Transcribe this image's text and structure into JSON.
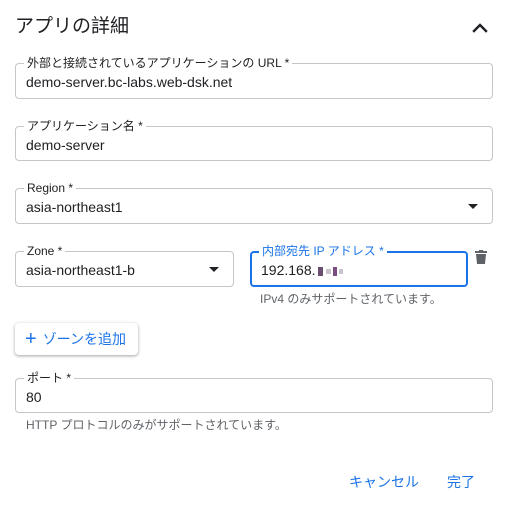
{
  "section": {
    "title": "アプリの詳細"
  },
  "fields": {
    "url": {
      "label": "外部と接続されているアプリケーションの URL *",
      "value": "demo-server.bc-labs.web-dsk.net"
    },
    "app_name": {
      "label": "アプリケーション名 *",
      "value": "demo-server"
    },
    "region": {
      "label": "Region *",
      "value": "asia-northeast1"
    },
    "zone": {
      "label": "Zone *",
      "value": "asia-northeast1-b"
    },
    "internal_ip": {
      "label": "内部宛先 IP アドレス *",
      "value": "192.168.",
      "hint": "IPv4 のみサポートされています。"
    },
    "port": {
      "label": "ポート *",
      "value": "80",
      "hint": "HTTP プロトコルのみがサポートされています。"
    }
  },
  "buttons": {
    "add_zone": "ゾーンを追加",
    "cancel": "キャンセル",
    "done": "完了"
  },
  "icons": {
    "collapse": "chevron-up-icon",
    "delete": "trash-icon",
    "add": "plus-icon",
    "dropdown": "caret-down-icon"
  },
  "colors": {
    "accent": "#1a73e8",
    "text": "#202124",
    "hint": "#5f6368",
    "border": "#c4c7c5"
  }
}
